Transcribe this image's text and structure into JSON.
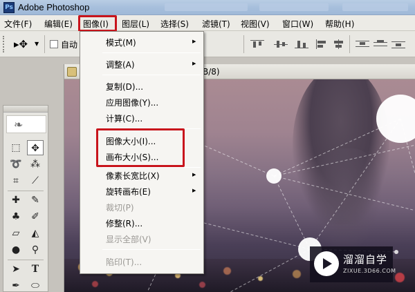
{
  "app": {
    "title": "Adobe Photoshop",
    "icon": "ps-icon"
  },
  "menubar": {
    "items": [
      {
        "label": "文件(F)"
      },
      {
        "label": "编辑(E)"
      },
      {
        "label": "图像(I)"
      },
      {
        "label": "图层(L)"
      },
      {
        "label": "选择(S)"
      },
      {
        "label": "滤镜(T)"
      },
      {
        "label": "视图(V)"
      },
      {
        "label": "窗口(W)"
      },
      {
        "label": "帮助(H)"
      }
    ],
    "active": "图像(I)"
  },
  "options_bar": {
    "auto_select_label": "自动"
  },
  "document": {
    "title_fragment": "B/8)"
  },
  "image_menu": {
    "items": [
      {
        "label": "模式(M)",
        "submenu": true,
        "enabled": true
      },
      {
        "label": "调整(A)",
        "submenu": true,
        "enabled": true
      },
      {
        "label": "复制(D)...",
        "enabled": true
      },
      {
        "label": "应用图像(Y)...",
        "enabled": true
      },
      {
        "label": "计算(C)...",
        "enabled": true
      },
      {
        "label": "图像大小(I)...",
        "enabled": true,
        "highlighted": true
      },
      {
        "label": "画布大小(S)...",
        "enabled": true,
        "highlighted": true
      },
      {
        "label": "像素长宽比(X)",
        "submenu": true,
        "enabled": true
      },
      {
        "label": "旋转画布(E)",
        "submenu": true,
        "enabled": true
      },
      {
        "label": "裁切(P)",
        "enabled": false
      },
      {
        "label": "修整(R)...",
        "enabled": true
      },
      {
        "label": "显示全部(V)",
        "enabled": false
      },
      {
        "label": "陷印(T)...",
        "enabled": false
      }
    ]
  },
  "watermark": {
    "name": "溜溜自学",
    "url": "ZIXUE.3D66.COM"
  },
  "colors": {
    "highlight_box": "#c8141c",
    "menu_bg": "#f6f5f2",
    "menubar_bg": "#ecebe6",
    "disabled_text": "#9a9894"
  }
}
